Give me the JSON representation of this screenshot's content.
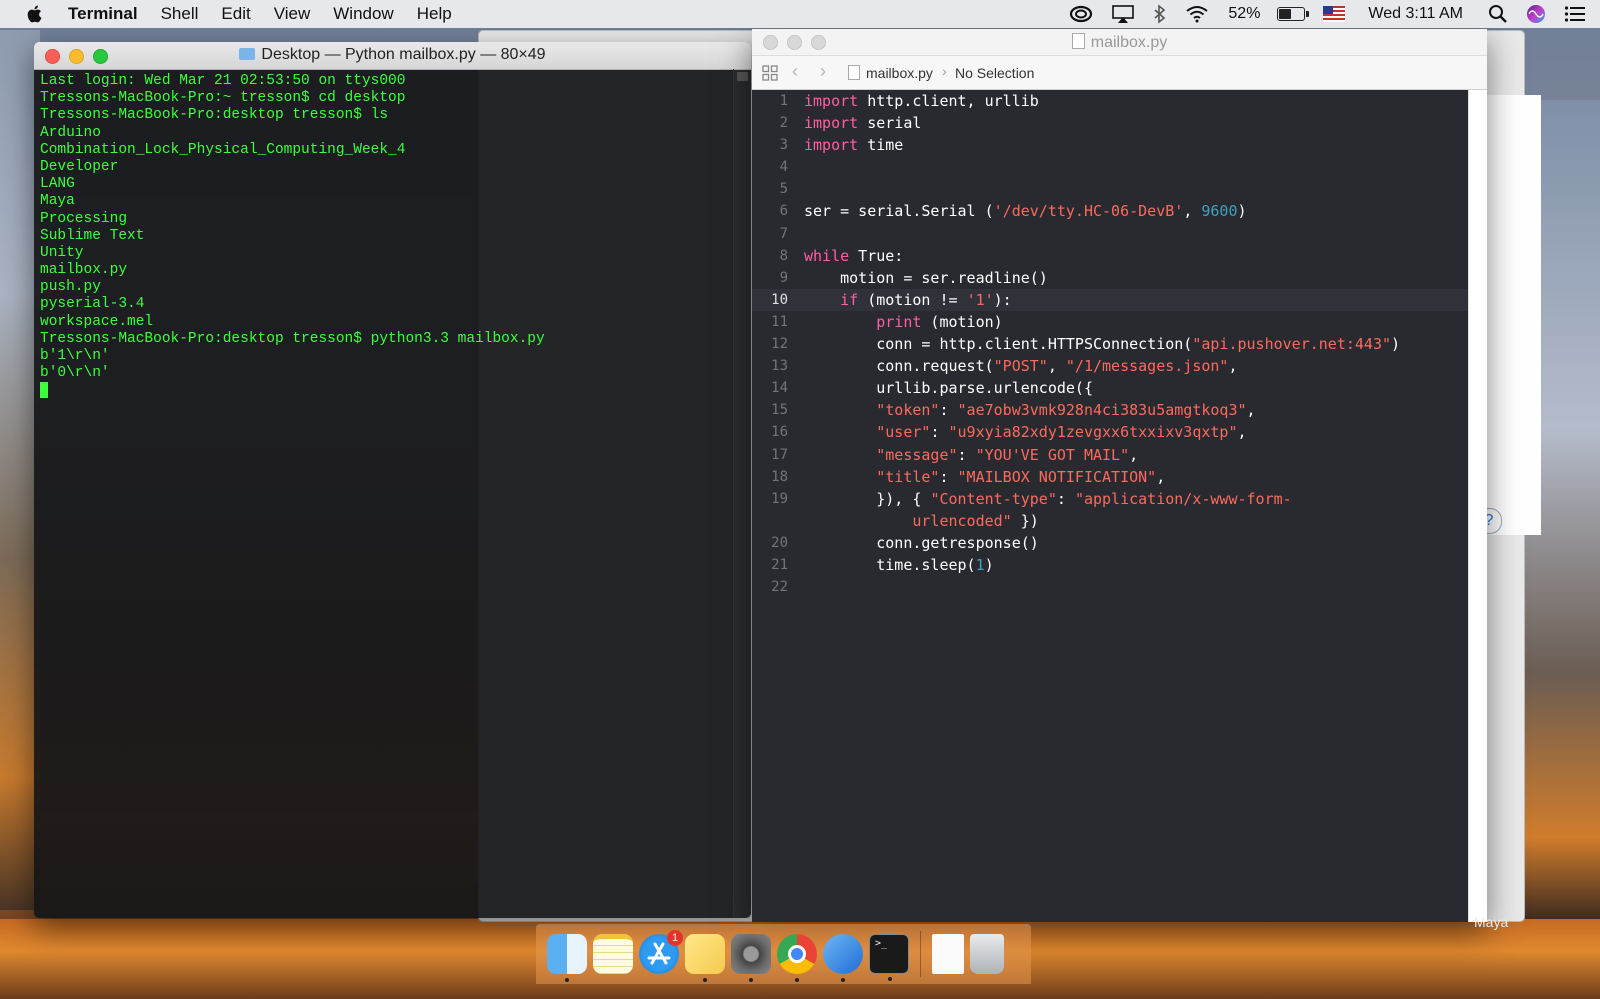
{
  "menubar": {
    "app_name": "Terminal",
    "items": [
      "Shell",
      "Edit",
      "View",
      "Window",
      "Help"
    ],
    "battery": "52%",
    "battery_level": 0.52,
    "clock": "Wed 3:11 AM",
    "icons": [
      "apple-icon",
      "creative-cloud-icon",
      "airplay-icon",
      "bluetooth-icon",
      "wifi-icon",
      "battery-icon",
      "us-flag-icon",
      "spotlight-icon",
      "siri-icon",
      "notification-center-icon"
    ]
  },
  "terminal": {
    "title": "Desktop — Python mailbox.py — 80×49",
    "lines": [
      "Last login: Wed Mar 21 02:53:50 on ttys000",
      "Tressons-MacBook-Pro:~ tresson$ cd desktop",
      "Tressons-MacBook-Pro:desktop tresson$ ls",
      "Arduino",
      "Combination_Lock_Physical_Computing_Week_4",
      "Developer",
      "LANG",
      "Maya",
      "Processing",
      "Sublime Text",
      "Unity",
      "mailbox.py",
      "push.py",
      "pyserial-3.4",
      "workspace.mel",
      "Tressons-MacBook-Pro:desktop tresson$ python3.3 mailbox.py",
      "b'1\\r\\n'",
      "b'0\\r\\n'"
    ]
  },
  "editor": {
    "title": "mailbox.py",
    "jumpbar_file": "mailbox.py",
    "jumpbar_selection": "No Selection",
    "current_line": 10,
    "code": [
      {
        "n": "1",
        "segs": [
          [
            "kw",
            "import"
          ],
          [
            "pl",
            " http.client, urllib"
          ]
        ]
      },
      {
        "n": "2",
        "segs": [
          [
            "kw",
            "import"
          ],
          [
            "pl",
            " serial"
          ]
        ]
      },
      {
        "n": "3",
        "segs": [
          [
            "kw",
            "import"
          ],
          [
            "pl",
            " time"
          ]
        ]
      },
      {
        "n": "4",
        "segs": []
      },
      {
        "n": "5",
        "segs": []
      },
      {
        "n": "6",
        "segs": [
          [
            "pl",
            "ser = serial.Serial ("
          ],
          [
            "str",
            "'/dev/tty.HC-06-DevB'"
          ],
          [
            "pl",
            ", "
          ],
          [
            "num",
            "9600"
          ],
          [
            "pl",
            ")"
          ]
        ]
      },
      {
        "n": "7",
        "segs": []
      },
      {
        "n": "8",
        "segs": [
          [
            "kw",
            "while"
          ],
          [
            "pl",
            " True:"
          ]
        ]
      },
      {
        "n": "9",
        "segs": [
          [
            "pl",
            "    motion = ser.readline()"
          ]
        ]
      },
      {
        "n": "10",
        "segs": [
          [
            "pl",
            "    "
          ],
          [
            "kw",
            "if"
          ],
          [
            "pl",
            " (motion != "
          ],
          [
            "str",
            "'1'"
          ],
          [
            "pl",
            "):"
          ]
        ]
      },
      {
        "n": "11",
        "segs": [
          [
            "pl",
            "        "
          ],
          [
            "kw",
            "print"
          ],
          [
            "pl",
            " (motion)"
          ]
        ]
      },
      {
        "n": "12",
        "segs": [
          [
            "pl",
            "        conn = http.client.HTTPSConnection("
          ],
          [
            "str",
            "\"api.pushover.net:443\""
          ],
          [
            "pl",
            ")"
          ]
        ]
      },
      {
        "n": "13",
        "segs": [
          [
            "pl",
            "        conn.request("
          ],
          [
            "str",
            "\"POST\""
          ],
          [
            "pl",
            ", "
          ],
          [
            "str",
            "\"/1/messages.json\""
          ],
          [
            "pl",
            ","
          ]
        ]
      },
      {
        "n": "14",
        "segs": [
          [
            "pl",
            "        urllib.parse.urlencode({"
          ]
        ]
      },
      {
        "n": "15",
        "segs": [
          [
            "pl",
            "        "
          ],
          [
            "str",
            "\"token\""
          ],
          [
            "pl",
            ": "
          ],
          [
            "str",
            "\"ae7obw3vmk928n4ci383u5amgtkoq3\""
          ],
          [
            "pl",
            ","
          ]
        ]
      },
      {
        "n": "16",
        "segs": [
          [
            "pl",
            "        "
          ],
          [
            "str",
            "\"user\""
          ],
          [
            "pl",
            ": "
          ],
          [
            "str",
            "\"u9xyia82xdy1zevgxx6txxixv3qxtp\""
          ],
          [
            "pl",
            ","
          ]
        ]
      },
      {
        "n": "17",
        "segs": [
          [
            "pl",
            "        "
          ],
          [
            "str",
            "\"message\""
          ],
          [
            "pl",
            ": "
          ],
          [
            "str",
            "\"YOU'VE GOT MAIL\""
          ],
          [
            "pl",
            ","
          ]
        ]
      },
      {
        "n": "18",
        "segs": [
          [
            "pl",
            "        "
          ],
          [
            "str",
            "\"title\""
          ],
          [
            "pl",
            ": "
          ],
          [
            "str",
            "\"MAILBOX NOTIFICATION\""
          ],
          [
            "pl",
            ","
          ]
        ]
      },
      {
        "n": "19",
        "segs": [
          [
            "pl",
            "        }), { "
          ],
          [
            "str",
            "\"Content-type\""
          ],
          [
            "pl",
            ": "
          ],
          [
            "str",
            "\"application/x-www-form-"
          ],
          [
            "pl",
            "\n            "
          ],
          [
            "str",
            "urlencoded\""
          ],
          [
            "pl",
            " })"
          ]
        ]
      },
      {
        "n": "20",
        "segs": [
          [
            "pl",
            "        conn.getresponse()"
          ]
        ]
      },
      {
        "n": "21",
        "segs": [
          [
            "pl",
            "        time.sleep("
          ],
          [
            "num",
            "1"
          ],
          [
            "pl",
            ")"
          ]
        ]
      },
      {
        "n": "22",
        "segs": []
      }
    ]
  },
  "background_window": {
    "help_label": "?"
  },
  "dock": {
    "apps": [
      "finder-icon",
      "notes-icon",
      "app-store-icon",
      "stickies-icon",
      "system-preferences-icon",
      "chrome-icon",
      "xcode-icon",
      "terminal-icon",
      "document-icon",
      "trash-icon"
    ],
    "app_store_badge": "1",
    "hover_label": "Maya"
  },
  "colors": {
    "terminal_text": "#3dff3d",
    "keyword": "#fc5fa3",
    "string": "#fc6a5d",
    "number": "#41a1c0",
    "editor_bg": "#292a30"
  }
}
